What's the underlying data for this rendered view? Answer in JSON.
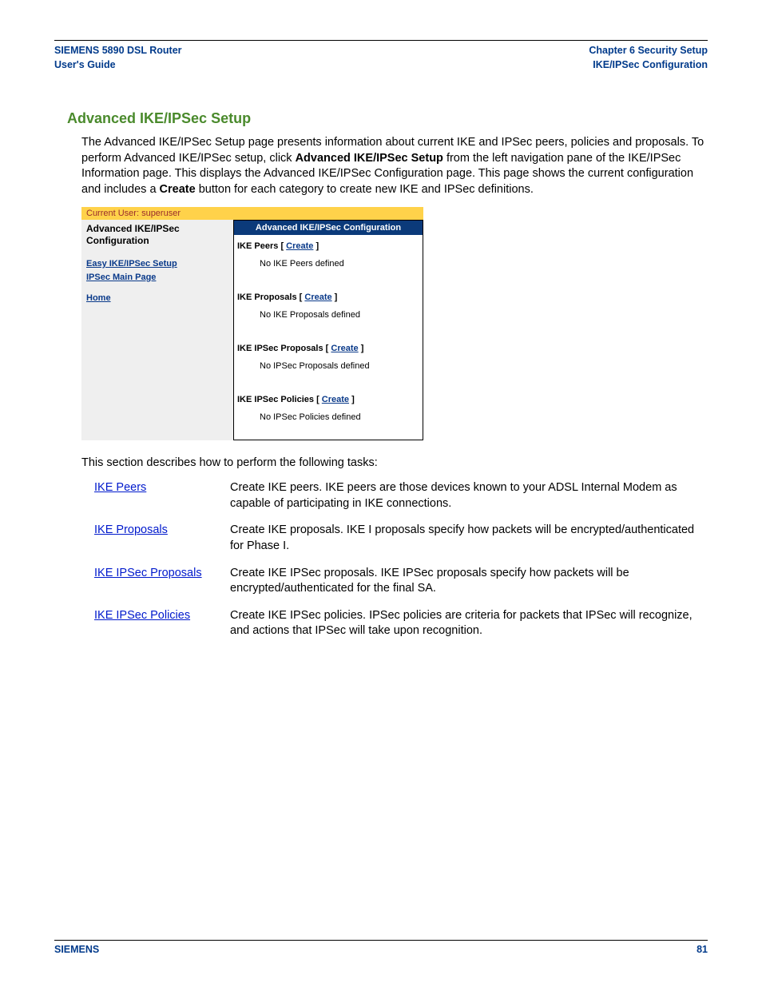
{
  "header": {
    "left_line1": "SIEMENS 5890 DSL Router",
    "left_line2": "User's Guide",
    "right_line1": "Chapter 6  Security Setup",
    "right_line2": "IKE/IPSec Configuration"
  },
  "section_heading": "Advanced IKE/IPSec Setup",
  "paragraph": {
    "p1a": "The Advanced IKE/IPSec Setup page presents information about current IKE and IPSec peers, policies and proposals. To perform Advanced IKE/IPSec setup, click ",
    "p1b_bold": "Advanced IKE/IPSec Setup",
    "p1c": " from the left navigation pane of the IKE/IPSec Information page. This displays the Advanced IKE/IPSec Configuration page. This page shows the current configuration and includes a ",
    "p1d_bold": "Create",
    "p1e": " button for each category to create new IKE and IPSec definitions."
  },
  "screenshot": {
    "current_user": "Current User: superuser",
    "left_title": "Advanced IKE/IPSec Configuration",
    "nav": {
      "easy": "Easy IKE/IPSec Setup",
      "main": "IPSec Main Page",
      "home": "Home"
    },
    "right_header": "Advanced IKE/IPSec Configuration",
    "sections": [
      {
        "label": "IKE Peers",
        "create": "Create",
        "empty": "No IKE Peers defined"
      },
      {
        "label": "IKE Proposals",
        "create": "Create",
        "empty": "No IKE Proposals defined"
      },
      {
        "label": "IKE IPSec Proposals",
        "create": "Create",
        "empty": "No IPSec Proposals defined"
      },
      {
        "label": "IKE IPSec Policies",
        "create": "Create",
        "empty": "No IPSec Policies defined"
      }
    ]
  },
  "tasks_intro": "This section describes how to perform the following tasks:",
  "tasks": [
    {
      "link": "IKE Peers",
      "desc": "Create IKE peers. IKE peers are those devices known to your ADSL Internal Modem as capable of participating in IKE connections."
    },
    {
      "link": "IKE Proposals",
      "desc": "Create IKE proposals. IKE I proposals specify how packets will be encrypted/authenticated for Phase I."
    },
    {
      "link": "IKE IPSec Proposals",
      "desc": "Create IKE IPSec proposals. IKE IPSec proposals specify how packets will be encrypted/authenticated for the final SA."
    },
    {
      "link": "IKE IPSec Policies",
      "desc": "Create IKE IPSec policies. IPSec policies are criteria for packets that IPSec will recognize, and actions that IPSec will take upon recognition."
    }
  ],
  "footer": {
    "brand": "SIEMENS",
    "page": "81"
  }
}
